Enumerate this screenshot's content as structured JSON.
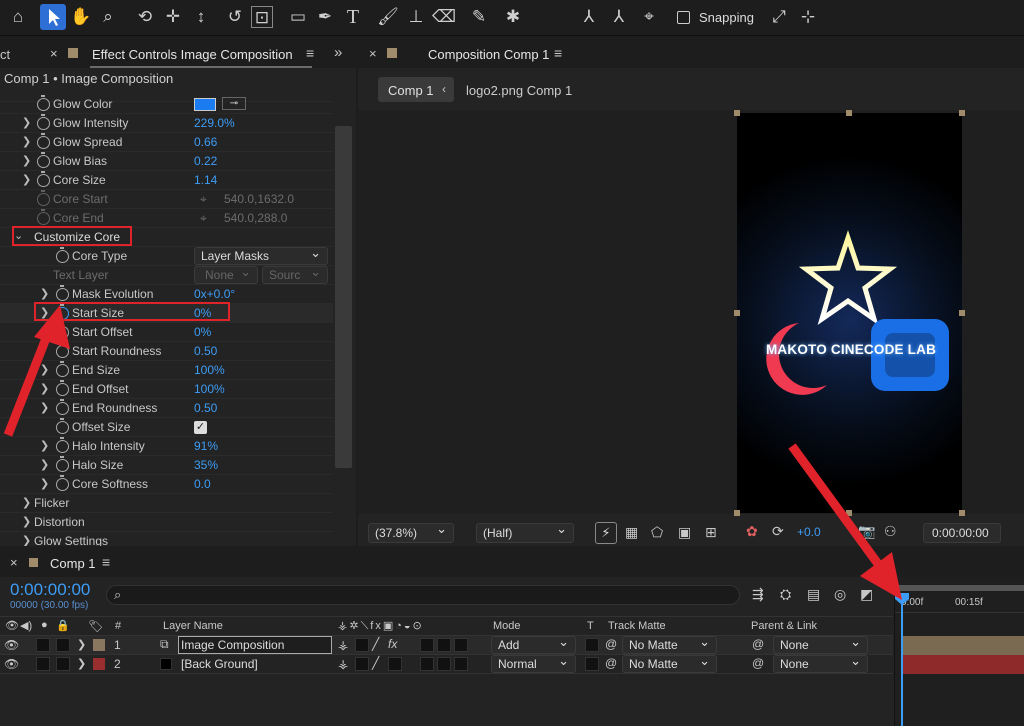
{
  "toolbar": {
    "snapping_label": "Snapping",
    "icons": [
      "home-icon",
      "selection-arrow-icon",
      "hand-icon",
      "zoom-icon",
      "orbit-icon",
      "pan-icon",
      "dolly-icon",
      "rotate-icon",
      "anchor-icon",
      "rectangle-icon",
      "pen-icon",
      "type-icon",
      "brush-icon",
      "stamp-icon",
      "eraser-icon",
      "roto-icon",
      "puppet-icon"
    ]
  },
  "effect_panel": {
    "tab_left": "ct",
    "tab_title": "Effect Controls Image Composition",
    "breadcrumb": "Comp 1 • Image Composition",
    "props": [
      {
        "label": "Glow Color",
        "value": ""
      },
      {
        "label": "Glow Intensity",
        "value": "229.0%"
      },
      {
        "label": "Glow Spread",
        "value": "0.66"
      },
      {
        "label": "Glow Bias",
        "value": "0.22"
      },
      {
        "label": "Core Size",
        "value": "1.14"
      },
      {
        "label": "Core Start",
        "value": "540.0,1632.0"
      },
      {
        "label": "Core End",
        "value": "540.0,288.0"
      }
    ],
    "group_label": "Customize Core",
    "core_type_label": "Core Type",
    "core_type_value": "Layer Masks",
    "text_layer_label": "Text Layer",
    "text_layer_value": "None",
    "text_layer_source": "Sourc",
    "sub_props": [
      {
        "label": "Mask Evolution",
        "value": "0x+0.0°"
      },
      {
        "label": "Start Size",
        "value": "0%"
      },
      {
        "label": "Start Offset",
        "value": "0%"
      },
      {
        "label": "Start Roundness",
        "value": "0.50"
      },
      {
        "label": "End Size",
        "value": "100%"
      },
      {
        "label": "End Offset",
        "value": "100%"
      },
      {
        "label": "End Roundness",
        "value": "0.50"
      },
      {
        "label": "Offset Size",
        "value": ""
      },
      {
        "label": "Halo Intensity",
        "value": "91%"
      },
      {
        "label": "Halo Size",
        "value": "35%"
      },
      {
        "label": "Core Softness",
        "value": "0.0"
      }
    ],
    "groups": [
      "Flicker",
      "Distortion",
      "Glow Settings"
    ]
  },
  "composition_panel": {
    "tab_title": "Composition Comp 1",
    "breadcrumb_active": "Comp 1",
    "breadcrumb_next": "logo2.png Comp 1",
    "logo_text": "MAKOTO CINECODE LAB",
    "zoom": "(37.8%)",
    "resolution": "(Half)",
    "exposure": "+0.0",
    "timecode": "0:00:00:00"
  },
  "timeline": {
    "tab_title": "Comp 1",
    "current_time": "0:00:00:00",
    "frame_info": "00000 (30.00 fps)",
    "search_placeholder": "",
    "columns": {
      "num": "#",
      "layer_name": "Layer Name",
      "mode": "Mode",
      "t": "T",
      "track_matte": "Track Matte",
      "parent": "Parent & Link"
    },
    "ruler": [
      "0:00f",
      "00:15f"
    ],
    "layers": [
      {
        "num": "1",
        "name": "Image Composition",
        "mode": "Add",
        "matte": "No Matte",
        "parent": "None",
        "color": "#8a7760"
      },
      {
        "num": "2",
        "name": "[Back Ground]",
        "mode": "Normal",
        "matte": "No Matte",
        "parent": "None",
        "color": "#9a2d2d"
      }
    ]
  },
  "colors": {
    "accent": "#3d9cf5",
    "glow_swatch": "#1a7cf0",
    "annotation": "#e0232a"
  }
}
